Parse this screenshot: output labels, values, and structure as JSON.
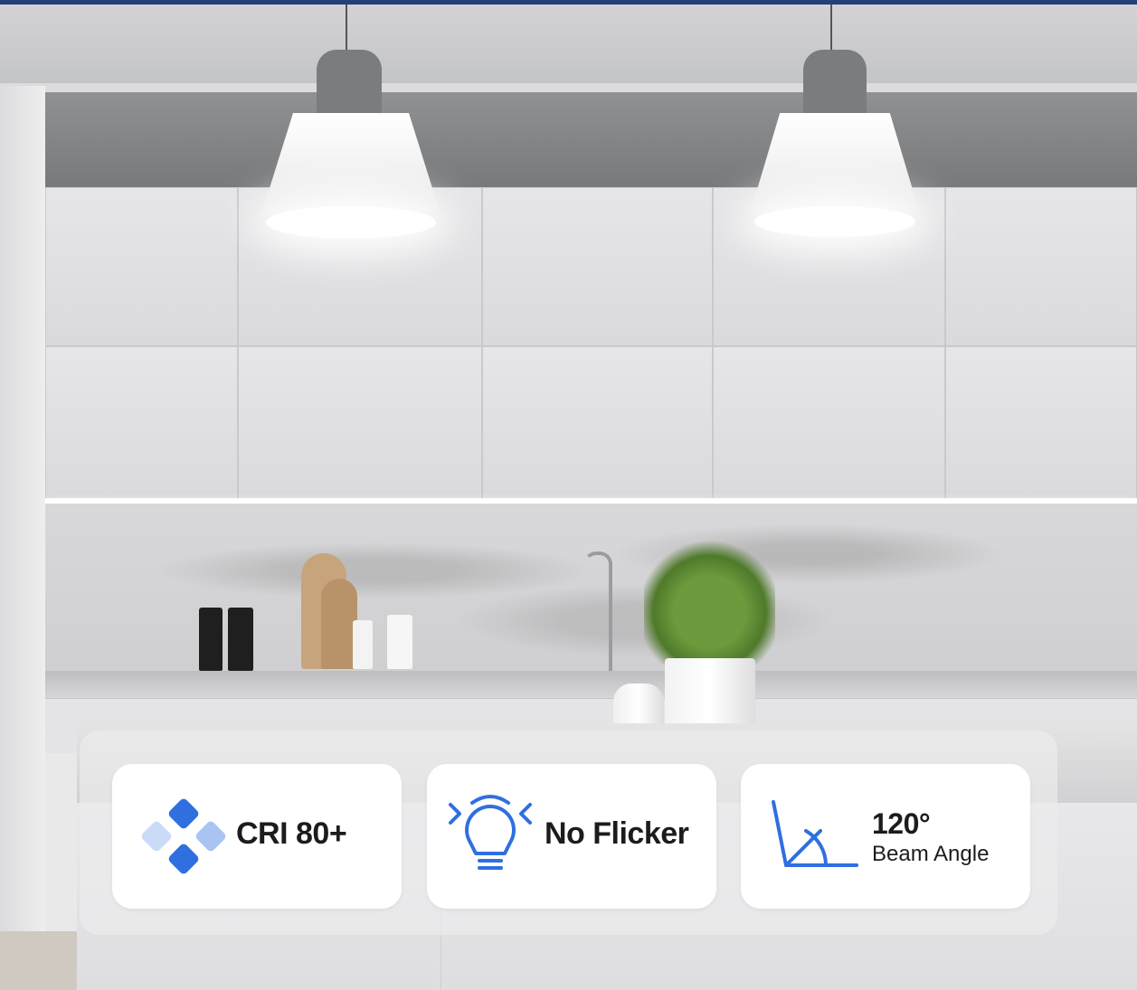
{
  "features": [
    {
      "icon": "color-diamond-icon",
      "title": "CRI 80+"
    },
    {
      "icon": "bulb-no-flicker-icon",
      "title": "No Flicker"
    },
    {
      "icon": "beam-angle-icon",
      "title": "120°",
      "subtitle": "Beam Angle"
    }
  ],
  "colors": {
    "accent_blue": "#2f6fe0",
    "accent_light_blue": "#b9d0f5",
    "card_background": "#ffffff",
    "top_rule": "#23407a"
  }
}
